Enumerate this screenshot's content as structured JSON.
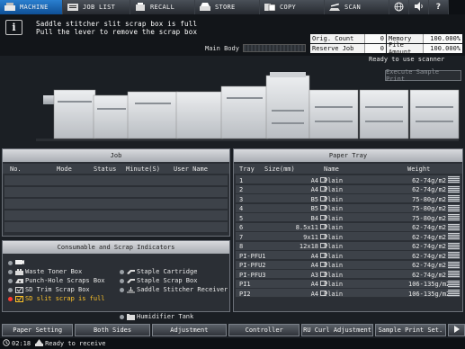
{
  "tabs": [
    {
      "label": "MACHINE",
      "icon": "printer-icon"
    },
    {
      "label": "JOB LIST",
      "icon": "job-list-icon"
    },
    {
      "label": "RECALL",
      "icon": "recall-icon"
    },
    {
      "label": "STORE",
      "icon": "store-icon"
    },
    {
      "label": "COPY",
      "icon": "copy-icon"
    },
    {
      "label": "SCAN",
      "icon": "scan-icon"
    }
  ],
  "message": {
    "line1": "Saddle stitcher slit scrap box is full",
    "line2": "Pull the lever to remove the scrap box"
  },
  "main_body_label": "Main Body",
  "counters": {
    "orig_count_label": "Orig. Count",
    "orig_count": "0",
    "memory_label": "Memory",
    "memory": "100.000%",
    "reserve_job_label": "Reserve Job",
    "reserve_job": "0",
    "file_amount_label": "File Amount",
    "file_amount": "100.000%"
  },
  "ready_text": "Ready to use scanner",
  "execute_label": "Execute Sample Print",
  "job": {
    "title": "Job",
    "columns": [
      "No.",
      "Mode",
      "Status",
      "Minute(S)",
      "User Name"
    ]
  },
  "paper": {
    "title": "Paper Tray",
    "columns": [
      "Tray",
      "Size(mm)",
      "Name",
      "Weight"
    ],
    "rows": [
      {
        "tray": "1",
        "size": "A4",
        "name": "Plain",
        "weight": "62-74g/m2"
      },
      {
        "tray": "2",
        "size": "A4",
        "name": "Plain",
        "weight": "62-74g/m2"
      },
      {
        "tray": "3",
        "size": "B5",
        "name": "Plain",
        "weight": "75-80g/m2"
      },
      {
        "tray": "4",
        "size": "B5",
        "name": "Plain",
        "weight": "75-80g/m2"
      },
      {
        "tray": "5",
        "size": "B4",
        "name": "Plain",
        "weight": "75-80g/m2"
      },
      {
        "tray": "6",
        "size": "8.5x11",
        "name": "Plain",
        "weight": "62-74g/m2"
      },
      {
        "tray": "7",
        "size": "9x11",
        "name": "Plain",
        "weight": "62-74g/m2"
      },
      {
        "tray": "8",
        "size": "12x18",
        "name": "Plain",
        "weight": "62-74g/m2"
      },
      {
        "tray": "PI-PFU1",
        "size": "A4",
        "name": "Plain",
        "weight": "62-74g/m2"
      },
      {
        "tray": "PI-PFU2",
        "size": "A4",
        "name": "Plain",
        "weight": "62-74g/m2"
      },
      {
        "tray": "PI-PFU3",
        "size": "A3",
        "name": "Plain",
        "weight": "62-74g/m2"
      },
      {
        "tray": "PI1",
        "size": "A4",
        "name": "Plain",
        "weight": "106-135g/m2"
      },
      {
        "tray": "PI2",
        "size": "A4",
        "name": "Plain",
        "weight": "106-135g/m2"
      }
    ]
  },
  "consumables": {
    "title": "Consumable and Scrap Indicators",
    "items": {
      "waste_toner": "Waste Toner Box",
      "punch_hole": "Punch-Hole Scraps Box",
      "sd_trim": "SD Trim Scrap Box",
      "sd_slit": "SD slit scrap is full",
      "staple_cartridge": "Staple Cartridge",
      "staple_scrap": "Staple Scrap Box",
      "saddle_receiver": "Saddle Stitcher Receiver",
      "humidifier": "Humidifier Tank"
    }
  },
  "bottom_buttons": [
    "Paper Setting",
    "Both Sides",
    "Adjustment",
    "Controller",
    "RU Curl Adjustment",
    "Sample Print Set."
  ],
  "status": {
    "time": "02:18",
    "text": "Ready to receive"
  },
  "colors": {
    "accent": "#1e6fc0",
    "warning": "#ffc428",
    "error": "#ff3b2f"
  }
}
